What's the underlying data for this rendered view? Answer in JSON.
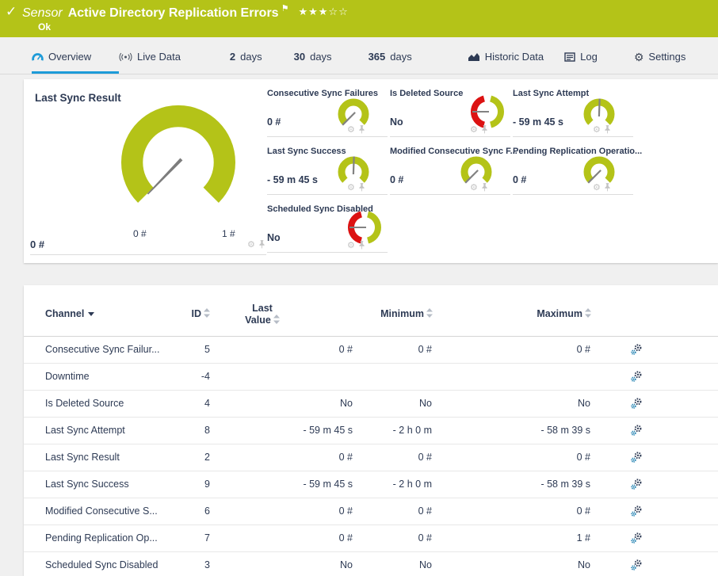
{
  "header": {
    "kind": "Sensor",
    "title": "Active Directory Replication Errors",
    "status": "Ok",
    "stars": "★★★☆☆",
    "rating_filled": 3,
    "rating_total": 5
  },
  "tabs": [
    {
      "label": "Overview",
      "active": true
    },
    {
      "label": "Live Data"
    },
    {
      "num": "2",
      "label": "days"
    },
    {
      "num": "30",
      "label": "days"
    },
    {
      "num": "365",
      "label": "days"
    },
    {
      "label": "Historic Data"
    },
    {
      "label": "Log"
    },
    {
      "label": "Settings"
    }
  ],
  "gauges": {
    "main": {
      "title": "Last Sync Result",
      "value": "0 #",
      "min_label": "0 #",
      "max_label": "1 #",
      "needle_deg": -136
    },
    "small": [
      {
        "title": "Consecutive Sync Failures",
        "value": "0 #",
        "type": "arc",
        "needle_deg": -135
      },
      {
        "title": "Is Deleted Source",
        "value": "No",
        "type": "boolean",
        "needle_deg": -90
      },
      {
        "title": "Last Sync Attempt",
        "value": "- 59 m 45 s",
        "type": "arc",
        "needle_deg": 2
      },
      {
        "title": "Last Sync Success",
        "value": "- 59 m 45 s",
        "type": "arc",
        "needle_deg": 2
      },
      {
        "title": "Modified Consecutive Sync F...",
        "value": "0 #",
        "type": "arc",
        "needle_deg": -135
      },
      {
        "title": "Pending Replication Operatio...",
        "value": "0 #",
        "type": "arc",
        "needle_deg": -135
      },
      {
        "title": "Scheduled Sync Disabled",
        "value": "No",
        "type": "boolean",
        "needle_deg": -90
      }
    ]
  },
  "table": {
    "columns": {
      "channel": "Channel",
      "id": "ID",
      "last_line1": "Last",
      "last_line2": "Value",
      "min": "Minimum",
      "max": "Maximum"
    },
    "rows": [
      {
        "channel": "Consecutive Sync Failur...",
        "id": "5",
        "last": "0 #",
        "min": "0 #",
        "max": "0 #"
      },
      {
        "channel": "Downtime",
        "id": "-4",
        "last": "",
        "min": "",
        "max": ""
      },
      {
        "channel": "Is Deleted Source",
        "id": "4",
        "last": "No",
        "min": "No",
        "max": "No"
      },
      {
        "channel": "Last Sync Attempt",
        "id": "8",
        "last": "- 59 m 45 s",
        "min": "- 2 h 0 m",
        "max": "- 58 m 39 s"
      },
      {
        "channel": "Last Sync Result",
        "id": "2",
        "last": "0 #",
        "min": "0 #",
        "max": "0 #"
      },
      {
        "channel": "Last Sync Success",
        "id": "9",
        "last": "- 59 m 45 s",
        "min": "- 2 h 0 m",
        "max": "- 58 m 39 s"
      },
      {
        "channel": "Modified Consecutive S...",
        "id": "6",
        "last": "0 #",
        "min": "0 #",
        "max": "0 #"
      },
      {
        "channel": "Pending Replication Op...",
        "id": "7",
        "last": "0 #",
        "min": "0 #",
        "max": "1 #"
      },
      {
        "channel": "Scheduled Sync Disabled",
        "id": "3",
        "last": "No",
        "min": "No",
        "max": "No"
      }
    ]
  },
  "colors": {
    "brand_green": "#b4c318",
    "status_red": "#dc1212",
    "accent_blue": "#1d9bd8",
    "text_dark": "#2d3a54"
  }
}
